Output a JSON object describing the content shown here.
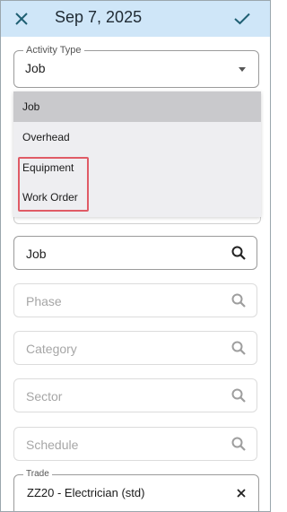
{
  "header": {
    "title": "Sep 7, 2025",
    "close_icon": "close-icon",
    "confirm_icon": "check-icon",
    "background": "#cfe6f8",
    "accent": "#1f5f73"
  },
  "activity_type": {
    "label": "Activity Type",
    "value": "Job",
    "options": [
      "Job",
      "Overhead",
      "Equipment",
      "Work Order"
    ]
  },
  "fields": {
    "job": "Job",
    "phase": "Phase",
    "category": "Category",
    "sector": "Sector",
    "schedule": "Schedule"
  },
  "trade": {
    "label": "Trade",
    "value": "ZZ20 - Electrician (std)"
  }
}
